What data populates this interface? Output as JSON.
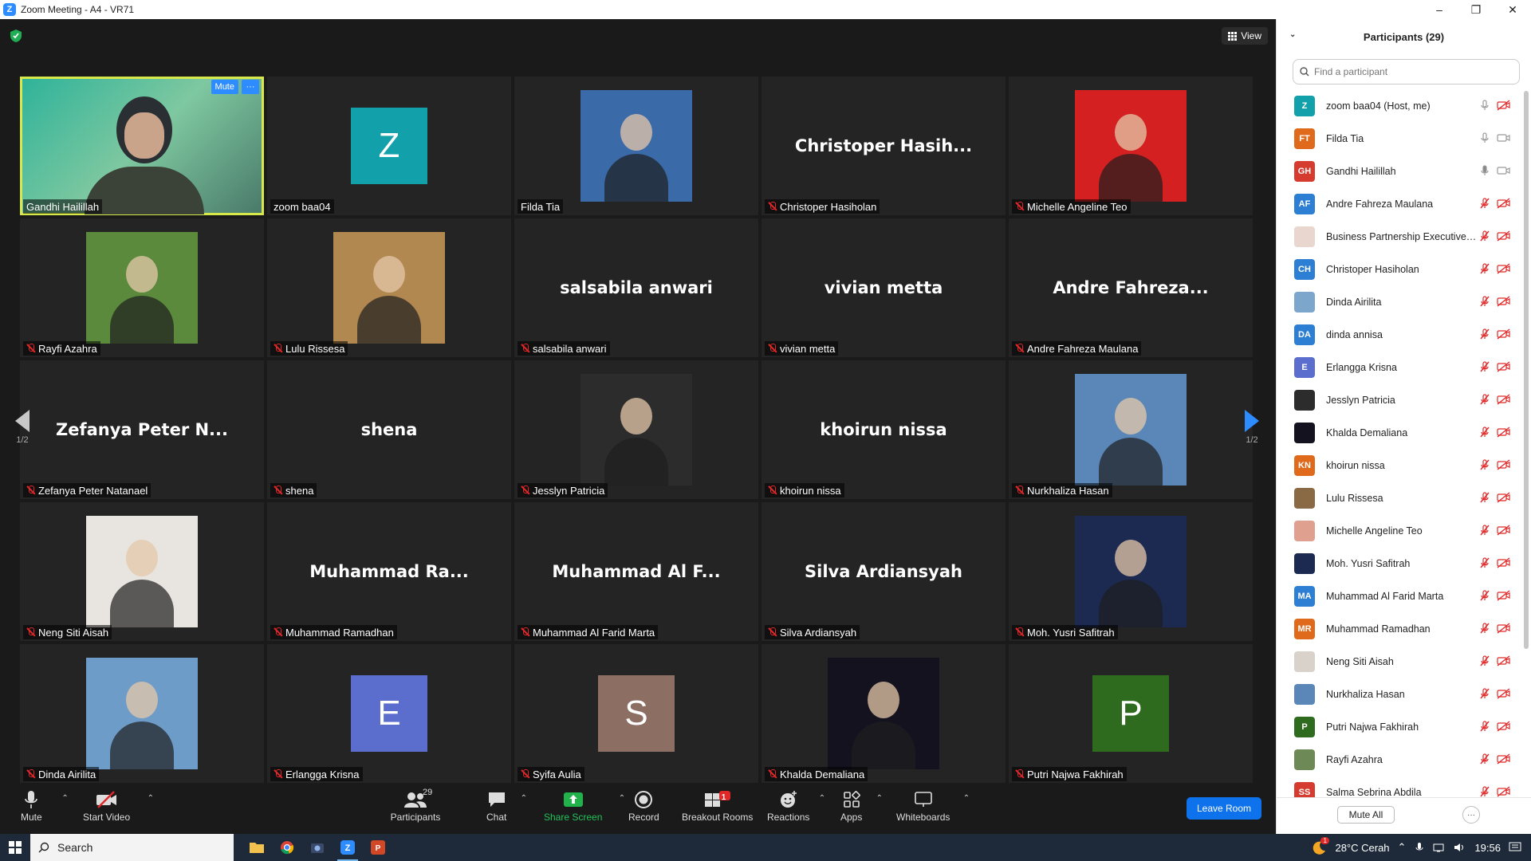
{
  "window": {
    "title": "Zoom Meeting - A4 - VR71"
  },
  "top_bar": {
    "view_label": "View"
  },
  "tiles": [
    {
      "name": "Gandhi Hailillah",
      "display": "video",
      "photo_bg": "#3fa877",
      "muted": false,
      "active": true,
      "mute_label": "Mute",
      "more_label": "···"
    },
    {
      "name": "zoom baa04",
      "display": "initial",
      "initial": "Z",
      "color": "#12a0ab",
      "muted": false
    },
    {
      "name": "Filda Tia",
      "display": "photo",
      "photo_bg": "#3a6aa8",
      "muted": false
    },
    {
      "name": "Christoper Hasiholan",
      "display": "name",
      "big": "Christoper  Hasih...",
      "muted": true
    },
    {
      "name": "Michelle Angeline Teo",
      "display": "photo",
      "photo_bg": "#d42020",
      "muted": true
    },
    {
      "name": "Rayfi Azahra",
      "display": "photo",
      "photo_bg": "#5b8a3c",
      "muted": true
    },
    {
      "name": "Lulu Rissesa",
      "display": "photo",
      "photo_bg": "#b08850",
      "muted": true
    },
    {
      "name": "salsabila anwari",
      "display": "name",
      "big": "salsabila anwari",
      "muted": true
    },
    {
      "name": "vivian metta",
      "display": "name",
      "big": "vivian metta",
      "muted": true
    },
    {
      "name": "Andre Fahreza Maulana",
      "display": "name",
      "big": "Andre  Fahreza...",
      "muted": true
    },
    {
      "name": "Zefanya Peter Natanael",
      "display": "name",
      "big": "Zefanya  Peter  N...",
      "muted": true
    },
    {
      "name": "shena",
      "display": "name",
      "big": "shena",
      "muted": true
    },
    {
      "name": "Jesslyn Patricia",
      "display": "photo",
      "photo_bg": "#2c2c2c",
      "muted": true
    },
    {
      "name": "khoirun nissa",
      "display": "name",
      "big": "khoirun nissa",
      "muted": true
    },
    {
      "name": "Nurkhaliza Hasan",
      "display": "photo",
      "photo_bg": "#5a86b8",
      "muted": true
    },
    {
      "name": "Neng Siti Aisah",
      "display": "photo",
      "photo_bg": "#e8e4df",
      "muted": true
    },
    {
      "name": "Muhammad Ramadhan",
      "display": "name",
      "big": "Muhammad  Ra...",
      "muted": true
    },
    {
      "name": "Muhammad Al Farid Marta",
      "display": "name",
      "big": "Muhammad  Al  F...",
      "muted": true
    },
    {
      "name": "Silva Ardiansyah",
      "display": "name",
      "big": "Silva Ardiansyah",
      "muted": true
    },
    {
      "name": "Moh. Yusri Safitrah",
      "display": "photo",
      "photo_bg": "#1c2a52",
      "muted": true
    },
    {
      "name": "Dinda Airilita",
      "display": "photo",
      "photo_bg": "#6e9cc8",
      "muted": true
    },
    {
      "name": "Erlangga Krisna",
      "display": "initial",
      "initial": "E",
      "color": "#5b6dcd",
      "muted": true
    },
    {
      "name": "Syifa Aulia",
      "display": "initial",
      "initial": "S",
      "color": "#8d6e63",
      "muted": true
    },
    {
      "name": "Khalda Demaliana",
      "display": "photo",
      "photo_bg": "#14121f",
      "muted": true
    },
    {
      "name": "Putri Najwa Fakhirah",
      "display": "initial",
      "initial": "P",
      "color": "#2e6b1e",
      "muted": true
    }
  ],
  "page_nav": {
    "left_page": "1/2",
    "right_page": "1/2"
  },
  "toolbar": {
    "mute": "Mute",
    "start_video": "Start Video",
    "participants": "Participants",
    "participants_count": "29",
    "chat": "Chat",
    "share_screen": "Share Screen",
    "record": "Record",
    "breakout_rooms": "Breakout Rooms",
    "breakout_badge": "1",
    "reactions": "Reactions",
    "apps": "Apps",
    "whiteboards": "Whiteboards",
    "leave": "Leave Room"
  },
  "panel": {
    "title": "Participants (29)",
    "search_placeholder": "Find a participant",
    "mute_all": "Mute All",
    "more": "···",
    "participants": [
      {
        "name": "zoom baa04 (Host, me)",
        "initials": "Z",
        "color": "#12a0ab",
        "mic": "on",
        "cam": "off"
      },
      {
        "name": "Filda Tia",
        "initials": "FT",
        "color": "#e06a1b",
        "mic": "on",
        "cam": "on"
      },
      {
        "name": "Gandhi Hailillah",
        "initials": "GH",
        "color": "#d63b2f",
        "mic": "active",
        "cam": "on"
      },
      {
        "name": "Andre Fahreza Maulana",
        "initials": "AF",
        "color": "#2d7fd3",
        "mic": "off",
        "cam": "off"
      },
      {
        "name": "Business Partnership Executive_...",
        "initials": "",
        "color": "#e9d6cf",
        "mic": "off",
        "cam": "off"
      },
      {
        "name": "Christoper Hasiholan",
        "initials": "CH",
        "color": "#2d7fd3",
        "mic": "off",
        "cam": "off"
      },
      {
        "name": "Dinda Airilita",
        "initials": "",
        "color": "#7da6cc",
        "mic": "off",
        "cam": "off"
      },
      {
        "name": "dinda annisa",
        "initials": "DA",
        "color": "#2d7fd3",
        "mic": "off",
        "cam": "off"
      },
      {
        "name": "Erlangga Krisna",
        "initials": "E",
        "color": "#5b6dcd",
        "mic": "off",
        "cam": "off"
      },
      {
        "name": "Jesslyn Patricia",
        "initials": "",
        "color": "#2c2c2c",
        "mic": "off",
        "cam": "off"
      },
      {
        "name": "Khalda Demaliana",
        "initials": "",
        "color": "#14121f",
        "mic": "off",
        "cam": "off"
      },
      {
        "name": "khoirun nissa",
        "initials": "KN",
        "color": "#e06a1b",
        "mic": "off",
        "cam": "off"
      },
      {
        "name": "Lulu Rissesa",
        "initials": "",
        "color": "#8a6a44",
        "mic": "off",
        "cam": "off"
      },
      {
        "name": "Michelle Angeline Teo",
        "initials": "",
        "color": "#e0a090",
        "mic": "off",
        "cam": "off"
      },
      {
        "name": "Moh. Yusri Safitrah",
        "initials": "",
        "color": "#1c2a52",
        "mic": "off",
        "cam": "off"
      },
      {
        "name": "Muhammad Al Farid Marta",
        "initials": "MA",
        "color": "#2d7fd3",
        "mic": "off",
        "cam": "off"
      },
      {
        "name": "Muhammad Ramadhan",
        "initials": "MR",
        "color": "#e06a1b",
        "mic": "off",
        "cam": "off"
      },
      {
        "name": "Neng Siti Aisah",
        "initials": "",
        "color": "#d9d2ca",
        "mic": "off",
        "cam": "off"
      },
      {
        "name": "Nurkhaliza Hasan",
        "initials": "",
        "color": "#5a86b8",
        "mic": "off",
        "cam": "off"
      },
      {
        "name": "Putri Najwa Fakhirah",
        "initials": "P",
        "color": "#2e6b1e",
        "mic": "off",
        "cam": "off"
      },
      {
        "name": "Rayfi Azahra",
        "initials": "",
        "color": "#6d8a56",
        "mic": "off",
        "cam": "off"
      },
      {
        "name": "Salma Sebrina Abdila",
        "initials": "SS",
        "color": "#d63b2f",
        "mic": "off",
        "cam": "off"
      }
    ]
  },
  "taskbar": {
    "search_label": "Search",
    "weather": "28°C  Cerah",
    "time": "19:56",
    "notification_badge": "1"
  }
}
